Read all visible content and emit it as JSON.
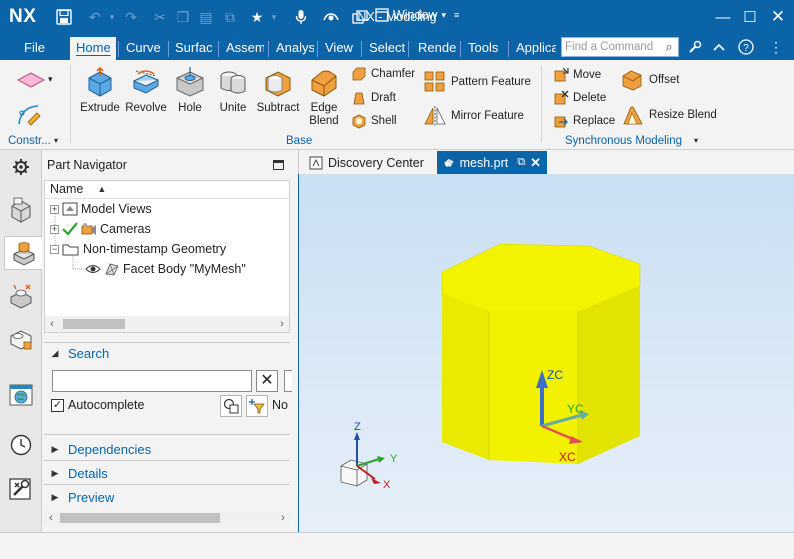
{
  "titlebar": {
    "logo": "NX",
    "window_menu": "Window",
    "title": "NX - Modeling"
  },
  "ribbon_tabs": [
    "File",
    "Home",
    "Curve",
    "Surface",
    "Assembly",
    "Analysis",
    "View",
    "Select",
    "Render",
    "Tools",
    "Application"
  ],
  "command_search": {
    "placeholder": "Find a Command"
  },
  "ribbon": {
    "construct_label": "Constr...",
    "base_buttons": [
      {
        "label": "Extrude"
      },
      {
        "label": "Revolve"
      },
      {
        "label": "Hole"
      },
      {
        "label": "Unite"
      },
      {
        "label": "Subtract"
      },
      {
        "label": "Edge\nBlend"
      }
    ],
    "base_small": [
      "Chamfer",
      "Draft",
      "Shell"
    ],
    "base_pattern": [
      "Pattern Feature",
      "Mirror Feature"
    ],
    "base_label": "Base",
    "sync_left": [
      "Move",
      "Delete",
      "Replace"
    ],
    "sync_right": [
      "Offset",
      "Resize Blend"
    ],
    "sync_label": "Synchronous Modeling"
  },
  "navigator": {
    "title": "Part Navigator",
    "column_header": "Name",
    "items": [
      {
        "label": "Model Views"
      },
      {
        "label": "Cameras"
      },
      {
        "label": "Non-timestamp Geometry"
      },
      {
        "label": "Facet Body \"MyMesh\""
      }
    ],
    "search_title": "Search",
    "autocomplete_label": "Autocomplete",
    "search_button_extra": "No",
    "sections": [
      "Dependencies",
      "Details",
      "Preview"
    ]
  },
  "doc_tabs": [
    {
      "label": "Discovery Center"
    },
    {
      "label": "mesh.prt"
    }
  ],
  "viewport": {
    "axes_main": {
      "zc": "ZC",
      "yc": "YC",
      "xc": "XC"
    },
    "axes_triad": {
      "z": "Z",
      "y": "Y",
      "x": "X"
    },
    "model_color": "#f3f300"
  }
}
